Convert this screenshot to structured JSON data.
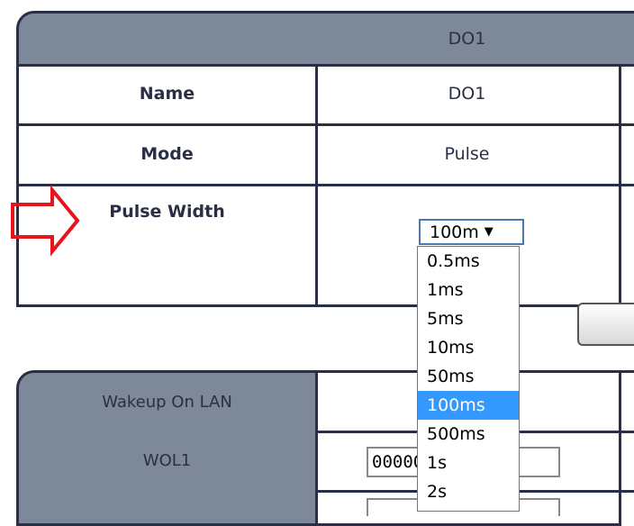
{
  "do_table": {
    "header_col": "DO1",
    "rows": [
      {
        "label": "Name",
        "value": "DO1"
      },
      {
        "label": "Mode",
        "value": "Pulse"
      },
      {
        "label": "Pulse Width",
        "value": ""
      }
    ]
  },
  "pulse_width_select": {
    "selected": "100m",
    "options": [
      "0.5ms",
      "1ms",
      "5ms",
      "10ms",
      "50ms",
      "100ms",
      "500ms",
      "1s",
      "2s"
    ],
    "highlighted": "100ms"
  },
  "wol_table": {
    "header": "Wakeup On LAN",
    "rows": [
      {
        "label": "WOL1",
        "value": "000000000000"
      }
    ]
  },
  "colors": {
    "header_bg": "#7d8899",
    "border": "#2b2f45",
    "highlight": "#3399ff",
    "arrow": "#e8141b"
  }
}
